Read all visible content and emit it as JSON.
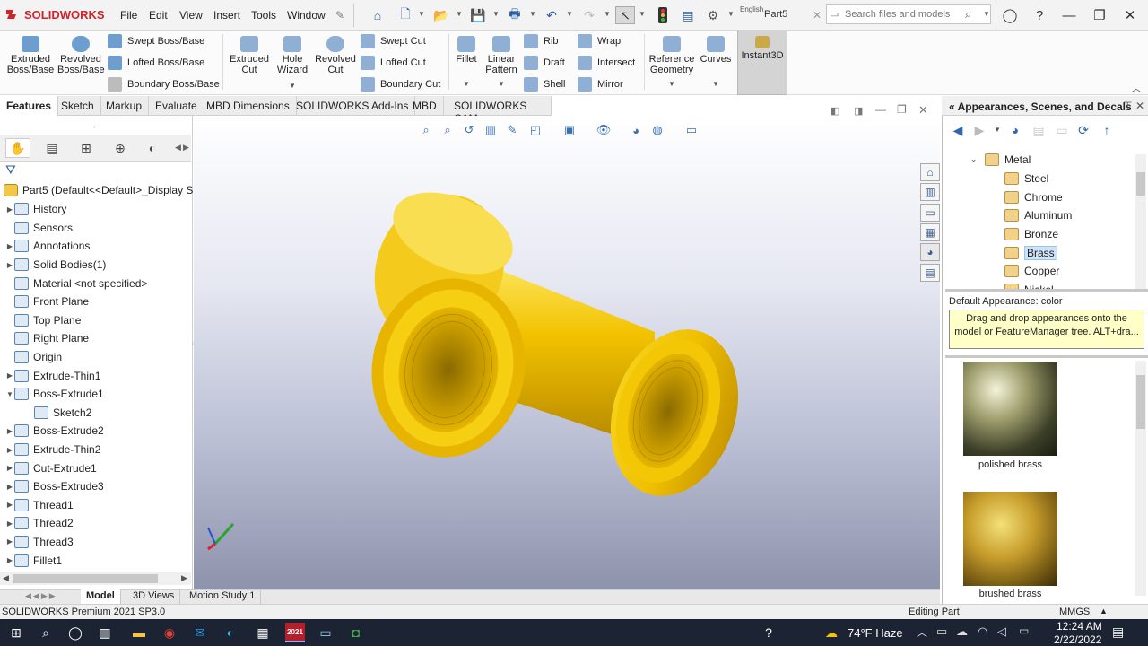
{
  "app": {
    "logo": "SOLIDWORKS",
    "doc_name": "Part5",
    "language": "English"
  },
  "menu": [
    "File",
    "Edit",
    "View",
    "Insert",
    "Tools",
    "Window"
  ],
  "search": {
    "placeholder": "Search files and models"
  },
  "ribbon": {
    "extruded_boss": "Extruded Boss/Base",
    "revolved_boss": "Revolved Boss/Base",
    "swept_boss": "Swept Boss/Base",
    "lofted_boss": "Lofted Boss/Base",
    "boundary_boss": "Boundary Boss/Base",
    "extruded_cut": "Extruded Cut",
    "hole_wizard": "Hole Wizard",
    "revolved_cut": "Revolved Cut",
    "swept_cut": "Swept Cut",
    "lofted_cut": "Lofted Cut",
    "boundary_cut": "Boundary Cut",
    "fillet": "Fillet",
    "linear_pattern": "Linear Pattern",
    "rib": "Rib",
    "draft": "Draft",
    "shell": "Shell",
    "wrap": "Wrap",
    "intersect": "Intersect",
    "mirror": "Mirror",
    "reference_geometry": "Reference Geometry",
    "curves": "Curves",
    "instant3d": "Instant3D"
  },
  "tabs": [
    "Features",
    "Sketch",
    "Markup",
    "Evaluate",
    "MBD Dimensions",
    "SOLIDWORKS Add-Ins",
    "MBD",
    "SOLIDWORKS CAM"
  ],
  "tree": {
    "root": "Part5  (Default<<Default>_Display Sta",
    "items": [
      "History",
      "Sensors",
      "Annotations",
      "Solid Bodies(1)",
      "Material <not specified>",
      "Front Plane",
      "Top Plane",
      "Right Plane",
      "Origin",
      "Extrude-Thin1",
      "Boss-Extrude1",
      "Sketch2",
      "Boss-Extrude2",
      "Extrude-Thin2",
      "Cut-Extrude1",
      "Boss-Extrude3",
      "Thread1",
      "Thread2",
      "Thread3",
      "Fillet1"
    ]
  },
  "bottom_tabs": [
    "Model",
    "3D Views",
    "Motion Study 1"
  ],
  "status": {
    "version": "SOLIDWORKS Premium 2021 SP3.0",
    "mode": "Editing Part",
    "units": "MMGS"
  },
  "taskpane": {
    "title": "Appearances, Scenes, and Decals",
    "folders": [
      "Metal",
      "Steel",
      "Chrome",
      "Aluminum",
      "Bronze",
      "Brass",
      "Copper",
      "Nickel"
    ],
    "default_appearance": "Default Appearance: color",
    "tooltip": "Drag and drop appearances onto the model or FeatureManager tree.  ALT+dra...",
    "swatches": [
      "polished brass",
      "brushed brass"
    ]
  },
  "taskbar": {
    "weather": "74°F  Haze",
    "time": "12:24 AM",
    "date": "2/22/2022",
    "badge": "2021"
  },
  "colors": {
    "model": "#f2c200",
    "accent": "#2b5fa8",
    "logo_red": "#d2232a",
    "tooltip_bg": "#ffffc8"
  }
}
